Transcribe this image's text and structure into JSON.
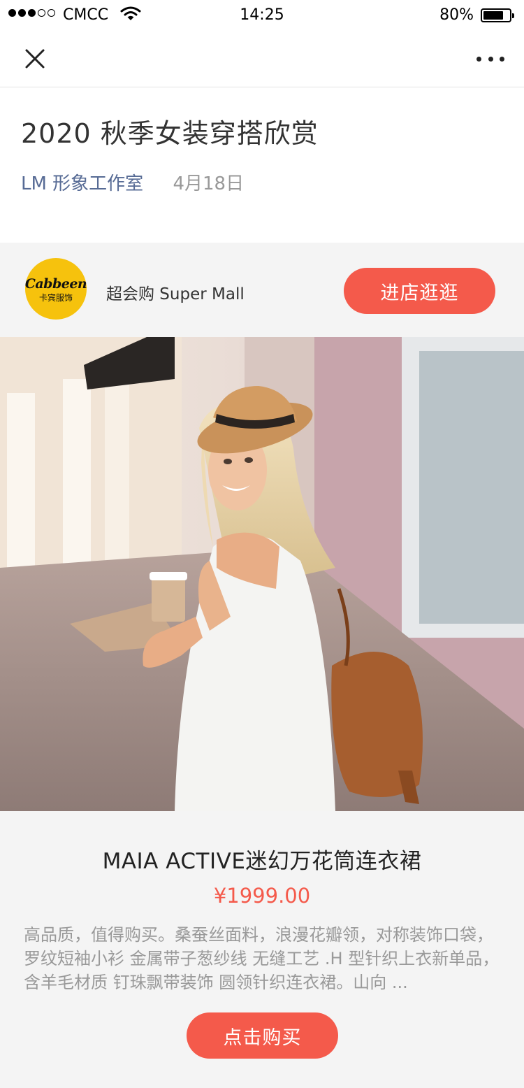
{
  "status_bar": {
    "signal_filled": 3,
    "signal_total": 5,
    "carrier": "CMCC",
    "time": "14:25",
    "battery_text": "80%",
    "battery_level": 0.8
  },
  "nav": {
    "close_icon": "close-icon",
    "more_icon": "more-icon"
  },
  "article": {
    "title": "2020 秋季女装穿搭欣赏",
    "author": "LM 形象工作室",
    "date": "4月18日"
  },
  "shop": {
    "logo_text": "Cabbeen",
    "logo_subtext": "卡宾服饰",
    "name": "超会购 Super Mall",
    "enter_label": "进店逛逛"
  },
  "product": {
    "title": "MAIA ACTIVE迷幻万花筒连衣裙",
    "price": "¥1999.00",
    "description": "高品质，值得购买。桑蚕丝面料，浪漫花瓣领，对称装饰口袋，罗纹短袖小衫 金属带子葱纱线 无缝工艺 .H 型针织上衣新单品，含羊毛材质 钉珠飘带装饰 圆领针织连衣裙。山向 ...",
    "buy_label": "点击购买"
  },
  "colors": {
    "accent": "#f45a4b",
    "link": "#576b95",
    "muted": "#999999",
    "logo_bg": "#f6c20d"
  }
}
